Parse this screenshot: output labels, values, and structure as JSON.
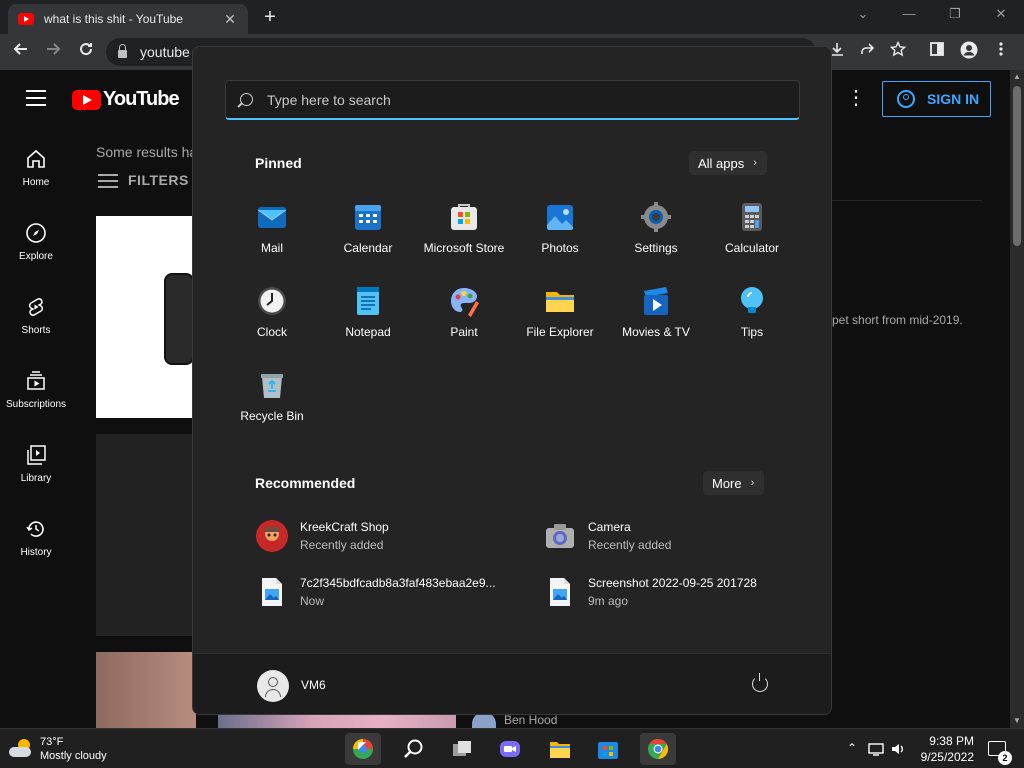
{
  "browser": {
    "tab_title": "what is this shit - YouTube",
    "tab_close": "✕",
    "new_tab": "+",
    "url": "youtube",
    "controls": {
      "chevron": "⌄",
      "minimize": "—",
      "restore": "❐",
      "close": "✕"
    },
    "toolbar_icons": [
      "arrow-left-icon",
      "arrow-right-icon",
      "reload-icon",
      "download-icon",
      "share-icon",
      "star-icon",
      "side-panel-icon",
      "profile-icon",
      "menu-dots-icon"
    ]
  },
  "youtube": {
    "logo_text": "YouTube",
    "sign_in": "SIGN IN",
    "more": "⋮",
    "results_note": "Some results ha",
    "filters": "FILTERS",
    "sidebar": [
      {
        "label": "Home",
        "icon": "home-icon"
      },
      {
        "label": "Explore",
        "icon": "compass-icon"
      },
      {
        "label": "Shorts",
        "icon": "shorts-icon"
      },
      {
        "label": "Subscriptions",
        "icon": "subscriptions-icon"
      },
      {
        "label": "Library",
        "icon": "library-icon"
      },
      {
        "label": "History",
        "icon": "history-icon"
      }
    ],
    "snippet_text": "pet short from mid-2019.",
    "channel_name": "Ben Hood",
    "accent": "#3ea6ff",
    "brand": "#ff0000"
  },
  "start_menu": {
    "search_placeholder": "Type here to search",
    "pinned_title": "Pinned",
    "all_apps": "All apps",
    "chevron": "›",
    "pinned": [
      {
        "label": "Mail",
        "icon": "mail-icon"
      },
      {
        "label": "Calendar",
        "icon": "calendar-icon"
      },
      {
        "label": "Microsoft Store",
        "icon": "store-icon"
      },
      {
        "label": "Photos",
        "icon": "photos-icon"
      },
      {
        "label": "Settings",
        "icon": "settings-icon"
      },
      {
        "label": "Calculator",
        "icon": "calculator-icon"
      },
      {
        "label": "Clock",
        "icon": "clock-icon"
      },
      {
        "label": "Notepad",
        "icon": "notepad-icon"
      },
      {
        "label": "Paint",
        "icon": "paint-icon"
      },
      {
        "label": "File Explorer",
        "icon": "folder-icon"
      },
      {
        "label": "Movies & TV",
        "icon": "movies-icon"
      },
      {
        "label": "Tips",
        "icon": "tips-icon"
      },
      {
        "label": "Recycle Bin",
        "icon": "recycle-bin-icon"
      }
    ],
    "recommended_title": "Recommended",
    "more": "More",
    "recommended": [
      {
        "name": "KreekCraft Shop",
        "sub": "Recently added",
        "icon": "kreekcraft-icon"
      },
      {
        "name": "Camera",
        "sub": "Recently added",
        "icon": "camera-icon"
      },
      {
        "name": "7c2f345bdfcadb8a3faf483ebaa2e9...",
        "sub": "Now",
        "icon": "image-file-icon"
      },
      {
        "name": "Screenshot 2022-09-25 201728",
        "sub": "9m ago",
        "icon": "image-file-icon"
      }
    ],
    "user": "VM6"
  },
  "taskbar": {
    "temperature": "73°F",
    "weather": "Mostly cloudy",
    "time": "9:38 PM",
    "date": "9/25/2022",
    "notification_count": "2",
    "tray": {
      "chevron": "⌃",
      "network": "▭",
      "volume": "🔈"
    }
  }
}
